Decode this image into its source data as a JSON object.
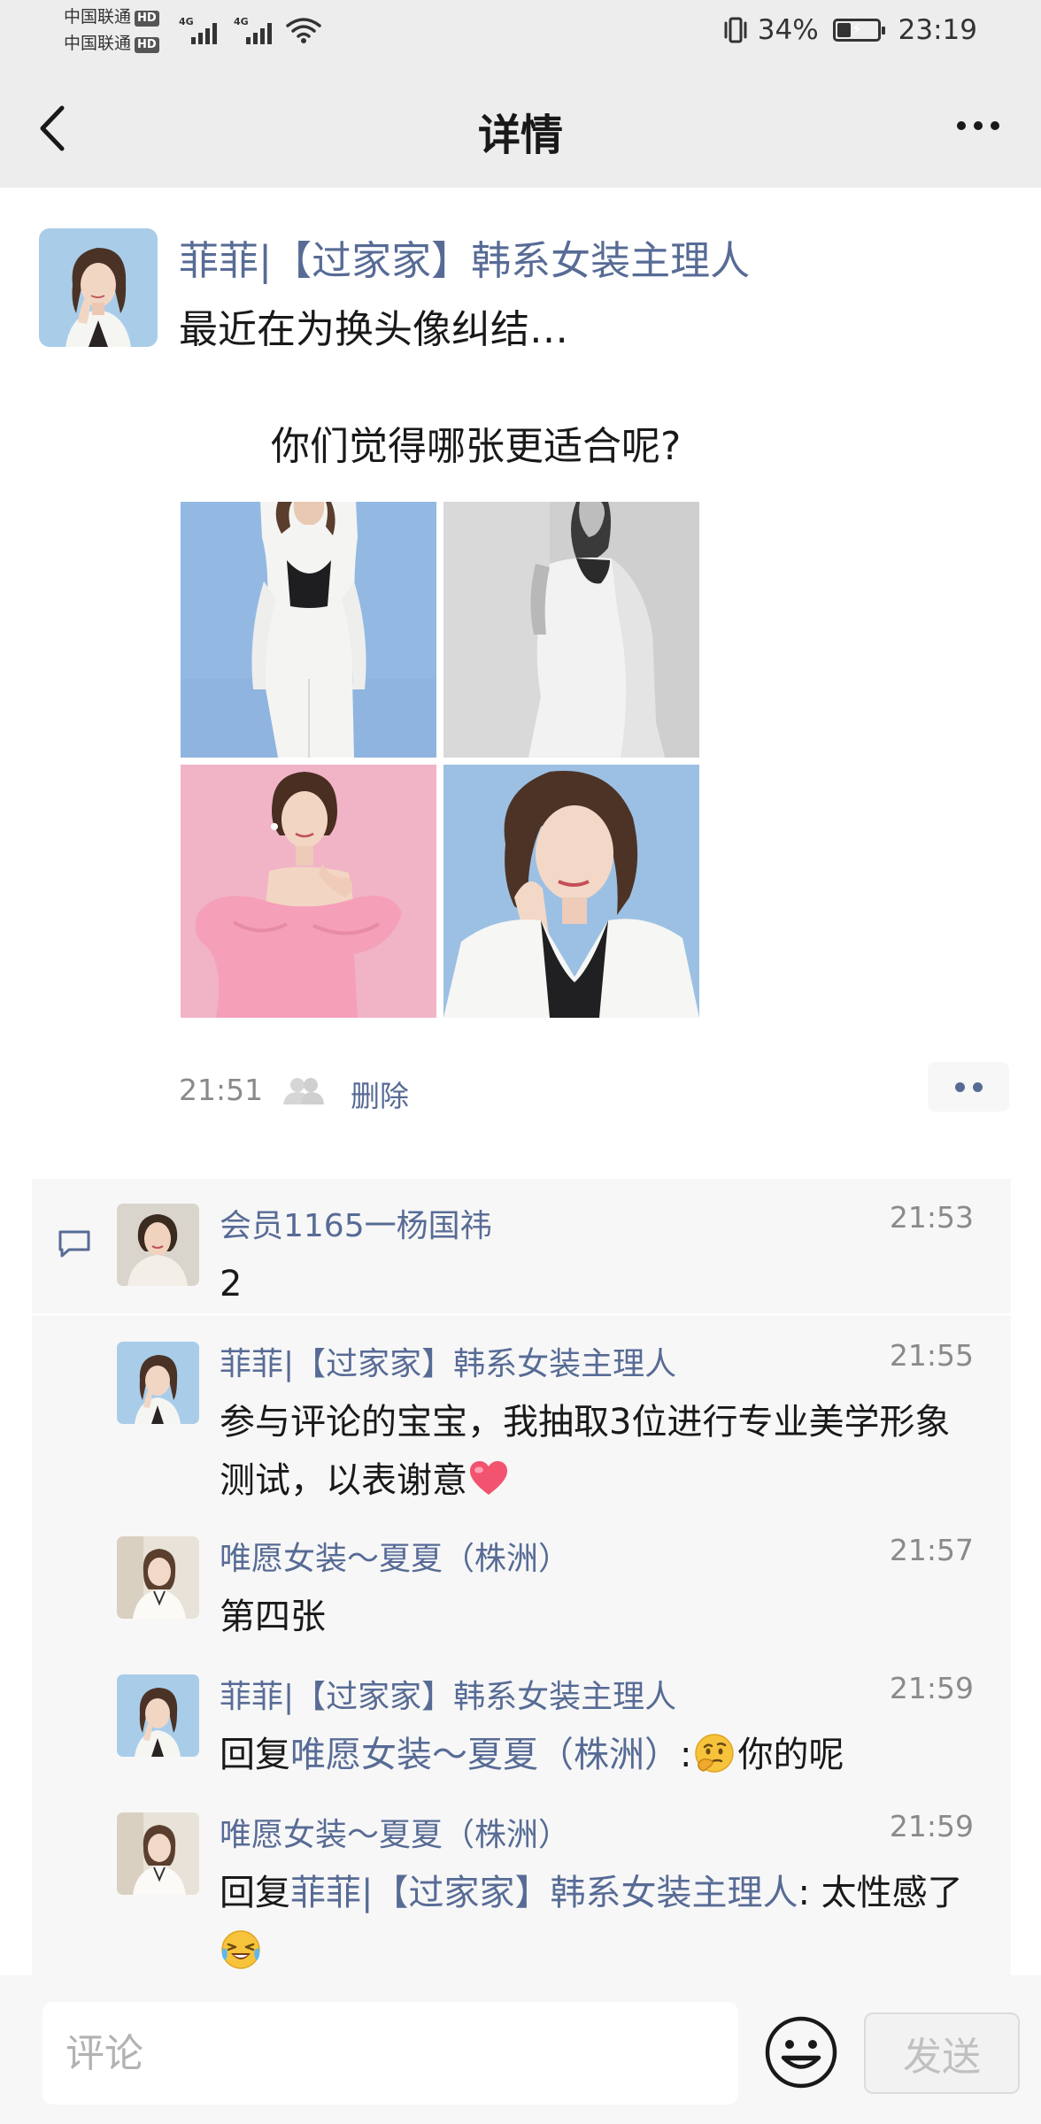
{
  "status_bar": {
    "carrier_1": "中国联通",
    "carrier_2": "中国联通",
    "hd_badge": "HD",
    "network_1": "4G",
    "network_2": "4G",
    "battery_percent": "34%",
    "battery_level": 0.34,
    "time": "23:19"
  },
  "nav": {
    "title": "详情",
    "back_icon": "chevron-left-icon",
    "more_icon": "more-dots-icon"
  },
  "post": {
    "author": "菲菲|【过家家】韩系女装主理人",
    "text_line1": "最近在为换头像纠结…",
    "text_line2": "你们觉得哪张更适合呢?",
    "images": [
      {
        "description": "white suit on blue background"
      },
      {
        "description": "black and white portrait"
      },
      {
        "description": "pink dress on pink background"
      },
      {
        "description": "white blazer close-up on blue background"
      }
    ],
    "time": "21:51",
    "delete_label": "删除",
    "friends_icon": "friends-icon",
    "action_icon": "two-dots-icon"
  },
  "comments": [
    {
      "name": "会员1165一杨国祎",
      "time": "21:53",
      "text": "2"
    },
    {
      "name": "菲菲|【过家家】韩系女装主理人",
      "time": "21:55",
      "text": "参与评论的宝宝，我抽取3位进行专业美学形象测试，以表谢意",
      "emoji": "heart-emoji"
    },
    {
      "name": "唯愿女装～夏夏（株洲）",
      "time": "21:57",
      "text": "第四张"
    },
    {
      "name": "菲菲|【过家家】韩系女装主理人",
      "time": "21:59",
      "reply_prefix": "回复",
      "reply_target": "唯愿女装～夏夏（株洲）",
      "reply_colon": ":",
      "text": "你的呢",
      "emoji": "thinking-emoji"
    },
    {
      "name": "唯愿女装～夏夏（株洲）",
      "time": "21:59",
      "reply_prefix": "回复",
      "reply_target": "菲菲|【过家家】韩系女装主理人",
      "reply_colon": ":",
      "text": " 太性感了",
      "emoji": "laughing-tears-emoji"
    }
  ],
  "input_bar": {
    "placeholder": "评论",
    "send_label": "发送",
    "emoji_icon": "smiley-icon"
  },
  "colors": {
    "link_blue": "#576b95",
    "background_gray": "#ededed",
    "comment_bg": "#f7f7f7"
  }
}
